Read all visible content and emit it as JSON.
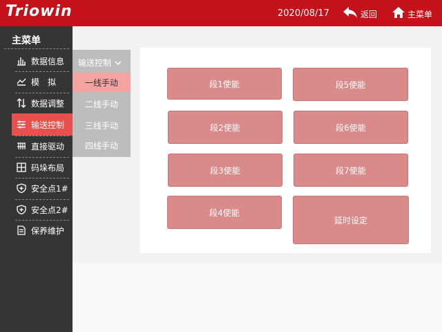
{
  "header": {
    "logo": "Triowin",
    "date": "2020/08/17",
    "back_label": "返回",
    "home_label": "主菜单",
    "bg_color": "#c4111a"
  },
  "sidebar": {
    "title": "主菜单",
    "items": [
      {
        "label": "数据信息",
        "icon": "bar-chart-icon",
        "active": false
      },
      {
        "label": "模　拟",
        "icon": "line-chart-icon",
        "active": false
      },
      {
        "label": "数据调整",
        "icon": "up-down-arrows-icon",
        "active": false
      },
      {
        "label": "输送控制",
        "icon": "sliders-icon",
        "active": true
      },
      {
        "label": "直接驱动",
        "icon": "drive-icon",
        "active": false
      },
      {
        "label": "码垛布局",
        "icon": "grid-icon",
        "active": false
      },
      {
        "label": "安全点1#",
        "icon": "shield-plus-icon",
        "active": false
      },
      {
        "label": "安全点2#",
        "icon": "shield-plus-icon",
        "active": false
      },
      {
        "label": "保养维护",
        "icon": "maintenance-icon",
        "active": false
      }
    ],
    "active_color": "#e8504e"
  },
  "submenu": {
    "title": "输送控制",
    "items": [
      "一线手动",
      "二线手动",
      "三线手动",
      "四线手动"
    ],
    "active_index": 0
  },
  "panel": {
    "buttons": [
      "段1使能",
      "段5使能",
      "段2使能",
      "段6使能",
      "段3使能",
      "段7使能",
      "段4使能",
      "延时设定"
    ],
    "button_color": "#da8a89"
  }
}
